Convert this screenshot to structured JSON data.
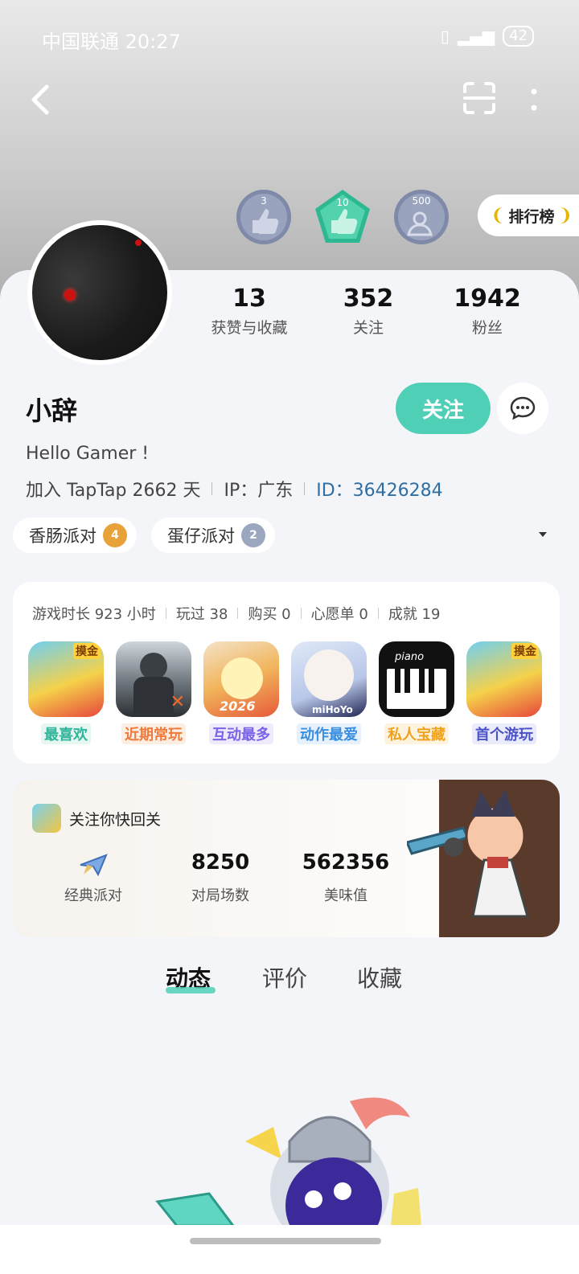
{
  "status_bar": {
    "carrier_time": "中国联通 20:27",
    "battery": "42"
  },
  "badges": [
    {
      "value": "3",
      "icon": "thumbs-up-badge"
    },
    {
      "value": "10",
      "icon": "thumbs-up-badge"
    },
    {
      "value": "500",
      "icon": "user-up-badge"
    }
  ],
  "rank_label": "排行榜",
  "profile": {
    "stats": [
      {
        "value": "13",
        "label": "获赞与收藏"
      },
      {
        "value": "352",
        "label": "关注"
      },
      {
        "value": "1942",
        "label": "粉丝"
      }
    ],
    "username": "小辞",
    "follow_label": "关注",
    "bio": "Hello Gamer !",
    "joined": "加入 TapTap 2662 天",
    "ip": "IP：广东",
    "id_label": "ID：",
    "id_value": "36426284"
  },
  "tags": [
    {
      "label": "香肠派对",
      "level": "4",
      "color": "#e8a23a"
    },
    {
      "label": "蛋仔派对",
      "level": "2",
      "color": "#9aa7bf"
    }
  ],
  "game_stats": {
    "playtime": "游戏时长 923 小时",
    "played": "玩过 38",
    "bought": "购买 0",
    "wishlist": "心愿单 0",
    "achievements": "成就 19"
  },
  "games": [
    {
      "label": "最喜欢",
      "color": "#31b59b",
      "bg": "#e6f7f2",
      "overlay": "摸金"
    },
    {
      "label": "近期常玩",
      "color": "#f07a3a",
      "bg": "#fdeee4",
      "overlay": ""
    },
    {
      "label": "互动最多",
      "color": "#7a63e8",
      "bg": "#efebfd",
      "overlay": ""
    },
    {
      "label": "动作最爱",
      "color": "#3b8fe0",
      "bg": "#e7f1fc",
      "overlay": ""
    },
    {
      "label": "私人宝藏",
      "color": "#f0a21c",
      "bg": "#fdf3df",
      "overlay": ""
    },
    {
      "label": "首个游玩",
      "color": "#4a52c7",
      "bg": "#ebecfb",
      "overlay": "摸金"
    }
  ],
  "party": {
    "title": "关注你快回关",
    "mode": "经典派对",
    "matches": "8250",
    "matches_label": "对局场数",
    "score": "562356",
    "score_label": "美味值"
  },
  "tabs": [
    "动态",
    "评价",
    "收藏"
  ]
}
